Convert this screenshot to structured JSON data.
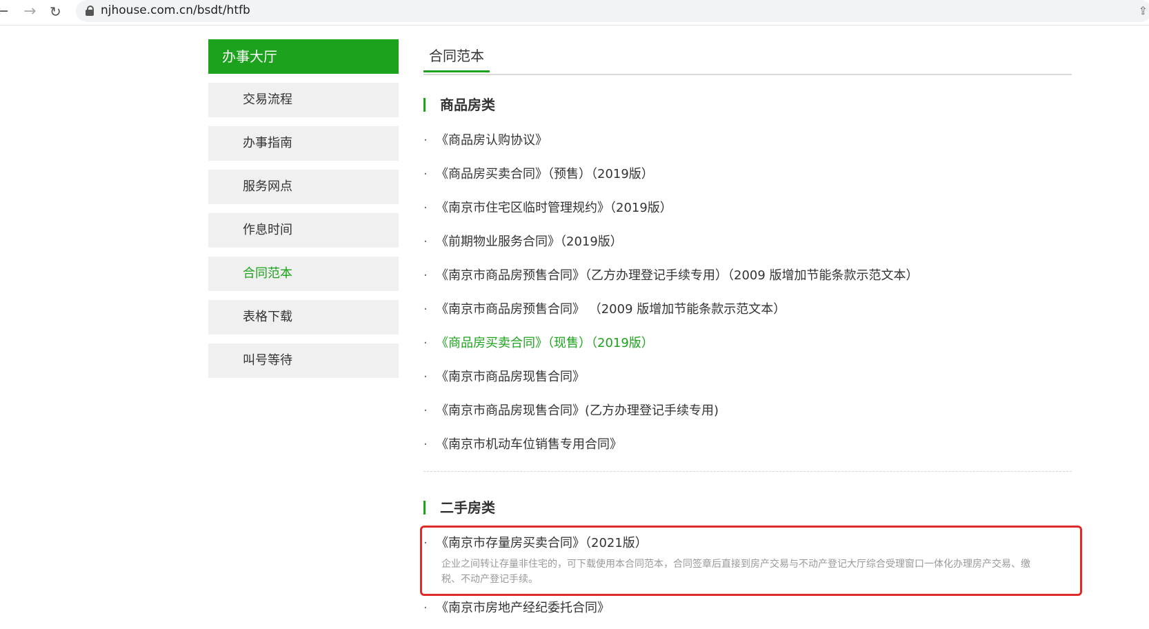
{
  "browser": {
    "url": "njhouse.com.cn/bsdt/htfb",
    "back_icon": "arrow-left-icon",
    "forward_icon": "arrow-right-icon",
    "reload_icon": "reload-icon"
  },
  "sidebar": {
    "header": "办事大厅",
    "items": [
      {
        "label": "交易流程"
      },
      {
        "label": "办事指南"
      },
      {
        "label": "服务网点"
      },
      {
        "label": "作息时间"
      },
      {
        "label": "合同范本"
      },
      {
        "label": "表格下载"
      },
      {
        "label": "叫号等待"
      }
    ],
    "active_index": 4
  },
  "main": {
    "tab": "合同范本",
    "sections": [
      {
        "title": "商品房类",
        "items": [
          "《商品房认购协议》",
          "《商品房买卖合同》（预售）（2019版）",
          "《南京市住宅区临时管理规约》（2019版）",
          "《前期物业服务合同》（2019版）",
          "《南京市商品房预售合同》（乙方办理登记手续专用）（2009 版增加节能条款示范文本）",
          "《南京市商品房预售合同》 （2009 版增加节能条款示范文本）",
          "《商品房买卖合同》（现售）（2019版）",
          "《南京市商品房现售合同》",
          "《南京市商品房现售合同》(乙方办理登记手续专用)",
          "《南京市机动车位销售专用合同》"
        ],
        "highlight_index": 6
      },
      {
        "title": "二手房类",
        "items": [
          {
            "label": "《南京市存量房买卖合同》（2021版）",
            "description": "企业之间转让存量非住宅的，可下载使用本合同范本，合同签章后直接到房产交易与不动产登记大厅综合受理窗口一体化办理房产交易、缴税、不动产登记手续。"
          },
          {
            "label": "《南京市房地产经纪委托合同》"
          }
        ]
      }
    ]
  },
  "colors": {
    "accent_green": "#1ca21c",
    "annotation_red": "#e02a2a"
  }
}
